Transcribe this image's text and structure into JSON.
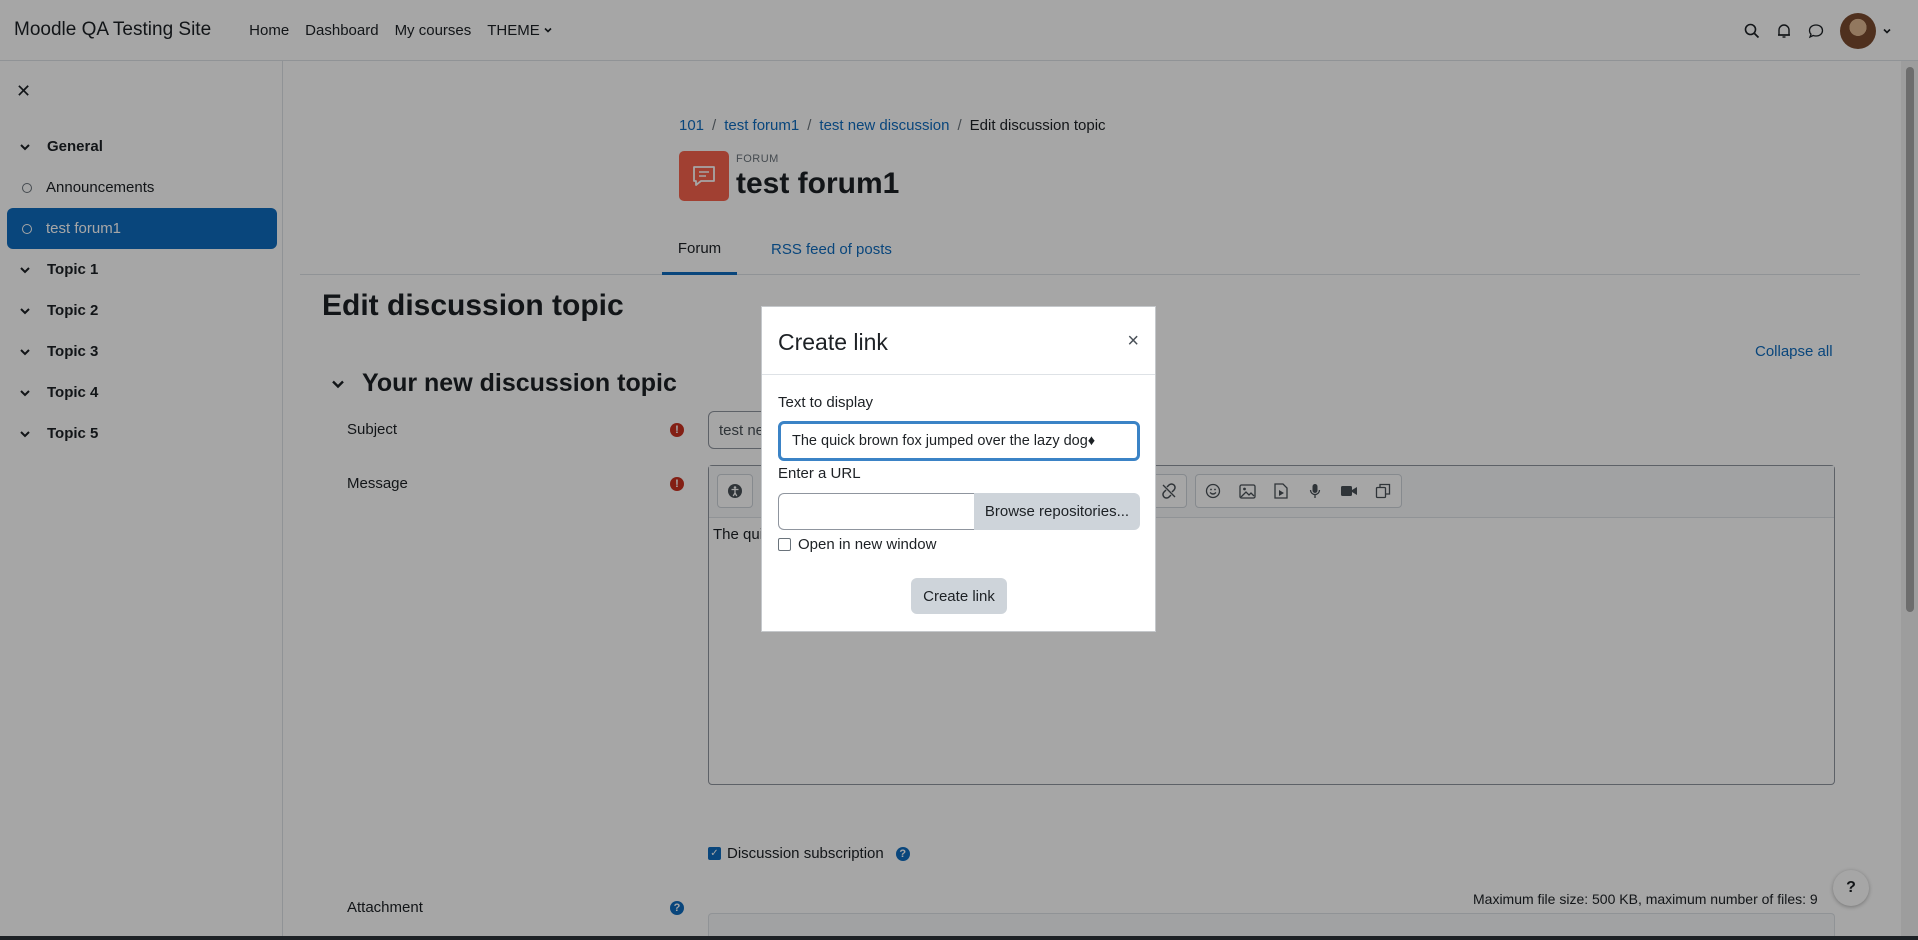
{
  "navbar": {
    "site_name": "Moodle QA Testing Site",
    "links": [
      "Home",
      "Dashboard",
      "My courses",
      "THEME"
    ]
  },
  "drawer": {
    "items": [
      {
        "label": "General",
        "type": "section"
      },
      {
        "label": "Announcements",
        "type": "activity"
      },
      {
        "label": "test forum1",
        "type": "activity",
        "active": true
      },
      {
        "label": "Topic 1",
        "type": "section"
      },
      {
        "label": "Topic 2",
        "type": "section"
      },
      {
        "label": "Topic 3",
        "type": "section"
      },
      {
        "label": "Topic 4",
        "type": "section"
      },
      {
        "label": "Topic 5",
        "type": "section"
      }
    ]
  },
  "breadcrumb": {
    "items": [
      "101",
      "test forum1",
      "test new discussion",
      "Edit discussion topic"
    ]
  },
  "header": {
    "activity_type": "FORUM",
    "title": "test forum1"
  },
  "tabs": [
    "Forum",
    "RSS feed of posts"
  ],
  "page": {
    "heading": "Edit discussion topic",
    "collapse_all": "Collapse all",
    "section_heading": "Your new discussion topic"
  },
  "form": {
    "subject_label": "Subject",
    "subject_value": "test ne",
    "message_label": "Message",
    "message_value": "The qui",
    "subscription_label": "Discussion subscription",
    "attachment_label": "Attachment",
    "max_size": "Maximum file size: 500 KB, maximum number of files: 9"
  },
  "modal": {
    "title": "Create link",
    "text_label": "Text to display",
    "text_value": "The quick brown fox jumped over the lazy dog♦",
    "url_label": "Enter a URL",
    "url_value": "",
    "browse_label": "Browse repositories...",
    "new_window_label": "Open in new window",
    "create_button": "Create link"
  },
  "colors": {
    "primary": "#0f6cbf",
    "forum_icon": "#f7634d",
    "required": "#ca3120"
  }
}
